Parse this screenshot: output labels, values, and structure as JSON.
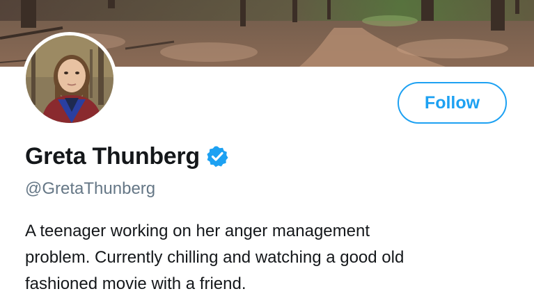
{
  "profile": {
    "display_name": "Greta Thunberg",
    "handle": "@GretaThunberg",
    "verified": true,
    "bio_lines": [
      "A teenager working on her anger management",
      "problem. Currently chilling and watching a good old",
      "fashioned movie with a friend."
    ]
  },
  "actions": {
    "follow_label": "Follow"
  },
  "icons": {
    "verified": "verified-badge-icon",
    "banner": "forest-path-banner",
    "avatar": "profile-avatar"
  },
  "colors": {
    "accent": "#1da1f2",
    "name_text": "#14171a",
    "handle_text": "#657786",
    "background": "#ffffff"
  }
}
